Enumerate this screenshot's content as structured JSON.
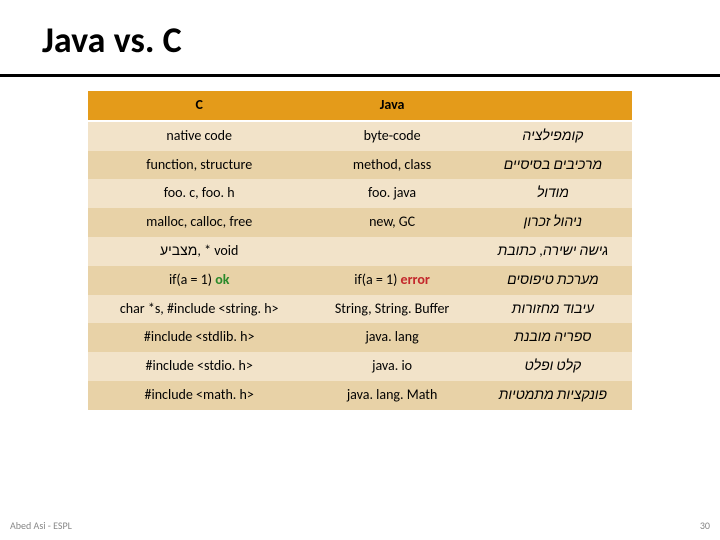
{
  "title": "Java vs. C",
  "headers": {
    "c": "C",
    "java": "Java",
    "topic": ""
  },
  "rows": [
    {
      "c": "native code",
      "java": "byte-code",
      "topic": "קומפילציה"
    },
    {
      "c": "function, structure",
      "java": "method, class",
      "topic": "מרכיבים בסיסיים"
    },
    {
      "c": "foo. c, foo. h",
      "java": "foo. java",
      "topic": "מודול"
    },
    {
      "c": "malloc, calloc, free",
      "java": "new, GC",
      "topic": "ניהול זכרון"
    },
    {
      "c": "מצביע, * void",
      "java": "",
      "topic": "גישה ישירה, כתובת"
    },
    {
      "c_prefix": "if(a = 1) ",
      "c_flag": "ok",
      "java_prefix": "if(a = 1) ",
      "java_flag": "error",
      "topic": "מערכת טיפוסים"
    },
    {
      "c": "char *s, #include <string. h>",
      "java": "String, String. Buffer",
      "topic": "עיבוד מחזורות"
    },
    {
      "c": "#include <stdlib. h>",
      "java": "java. lang",
      "topic": "ספריה מובנת"
    },
    {
      "c": "#include <stdio. h>",
      "java": "java. io",
      "topic": "קלט ופלט"
    },
    {
      "c": "#include <math. h>",
      "java": "java. lang. Math",
      "topic": "פונקציות מתמטיות"
    }
  ],
  "footer_left": "Abed Asi - ESPL",
  "footer_right": "30"
}
